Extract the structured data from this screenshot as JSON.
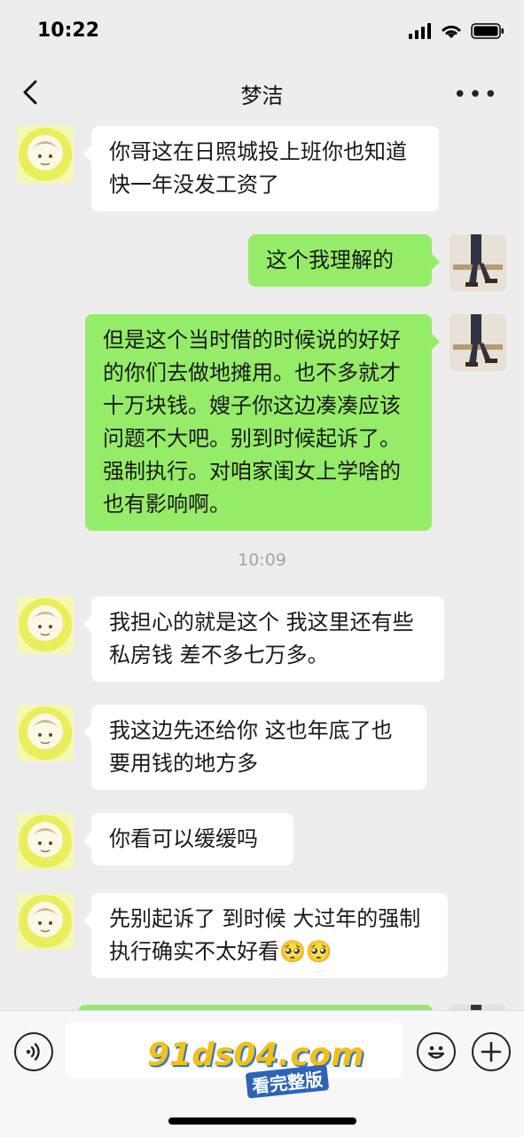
{
  "status_bar": {
    "time": "10:22"
  },
  "header": {
    "title": "梦洁"
  },
  "messages": [
    {
      "side": "left",
      "text": "你哥这在日照城投上班你也知道 快一年没发工资了"
    },
    {
      "side": "right",
      "text": "这个我理解的"
    },
    {
      "side": "right",
      "text": "但是这个当时借的时候说的好好的你们去做地摊用。也不多就才十万块钱。嫂子你这边凑凑应该问题不大吧。别到时候起诉了。强制执行。对咱家闺女上学啥的也有影响啊。"
    },
    {
      "side": "left",
      "text": "我担心的就是这个 我这里还有些私房钱 差不多七万多。"
    },
    {
      "side": "left",
      "text": "我这边先还给你 这也年底了也要用钱的地方多"
    },
    {
      "side": "left",
      "text": "你看可以缓缓吗"
    },
    {
      "side": "left",
      "text": "先别起诉了 到时候 大过年的强制执行确实不太好看🥺🥺"
    }
  ],
  "timestamp": "10:09",
  "watermark": {
    "line1": "91ds04.com",
    "line2": "看完整版"
  },
  "icons": [
    "back-icon",
    "more-icon",
    "voice-icon",
    "emoji-icon",
    "plus-icon"
  ]
}
